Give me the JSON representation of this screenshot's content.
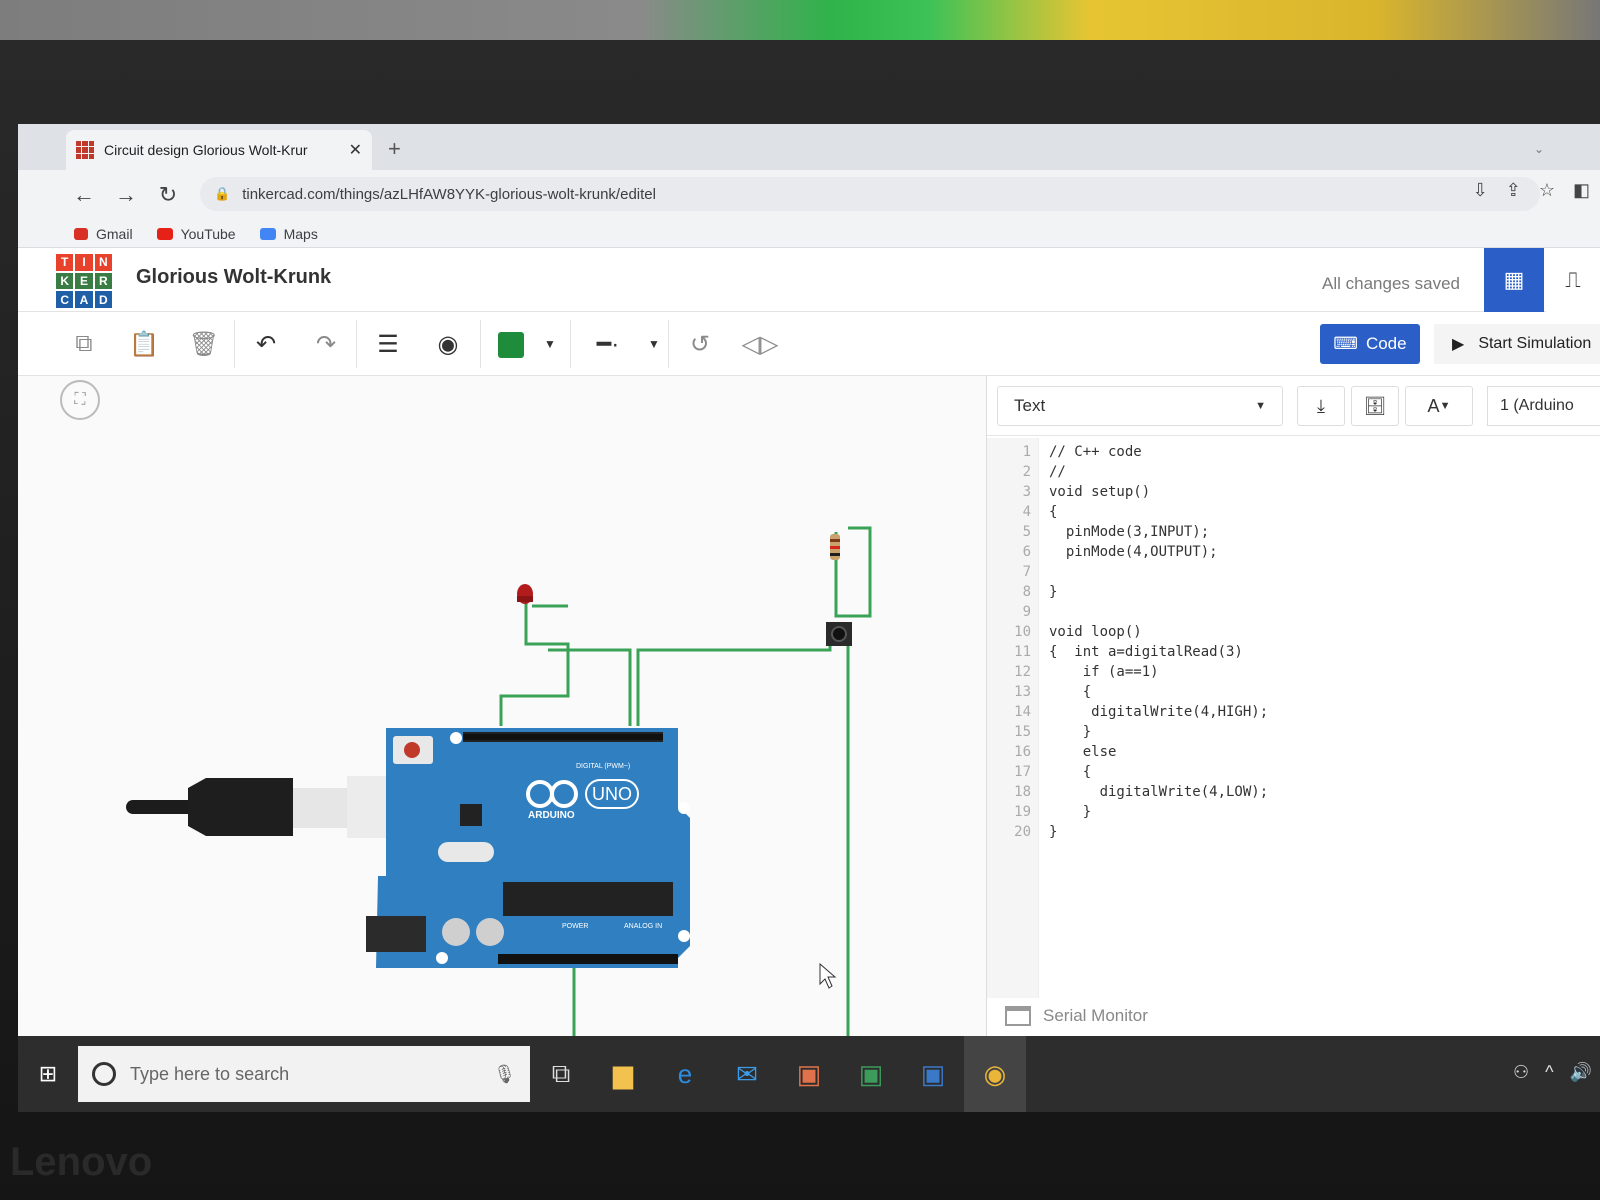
{
  "browser": {
    "tab_title": "Circuit design Glorious Wolt-Krur",
    "url": "tinkercad.com/things/azLHfAW8YYK-glorious-wolt-krunk/editel",
    "bookmarks": [
      "Gmail",
      "YouTube",
      "Maps"
    ]
  },
  "app": {
    "logo_letters": [
      "T",
      "I",
      "N",
      "K",
      "E",
      "R",
      "C",
      "A",
      "D"
    ],
    "project_name": "Glorious Wolt-Krunk",
    "save_status": "All changes saved",
    "code_button": "Code",
    "sim_button": "Start Simulation"
  },
  "code_panel": {
    "mode": "Text",
    "device": "1 (Arduino",
    "lines": [
      "// C++ code",
      "//",
      "void setup()",
      "{",
      "  pinMode(3,INPUT);",
      "  pinMode(4,OUTPUT);",
      "",
      "}",
      "",
      "void loop()",
      "{  int a=digitalRead(3)",
      "    if (a==1)",
      "    {",
      "     digitalWrite(4,HIGH);",
      "    }",
      "    else",
      "    {",
      "      digitalWrite(4,LOW);",
      "    }",
      "}"
    ],
    "serial_monitor": "Serial Monitor"
  },
  "board": {
    "brand": "ARDUINO",
    "model": "UNO",
    "digital_label": "DIGITAL (PWM~)",
    "power_label": "POWER",
    "analog_label": "ANALOG IN"
  },
  "taskbar": {
    "search_placeholder": "Type here to search"
  },
  "laptop_brand": "Lenovo",
  "colors": {
    "accent": "#2b5fc7",
    "wire": "#3aa257",
    "board": "#2f7fc1"
  }
}
